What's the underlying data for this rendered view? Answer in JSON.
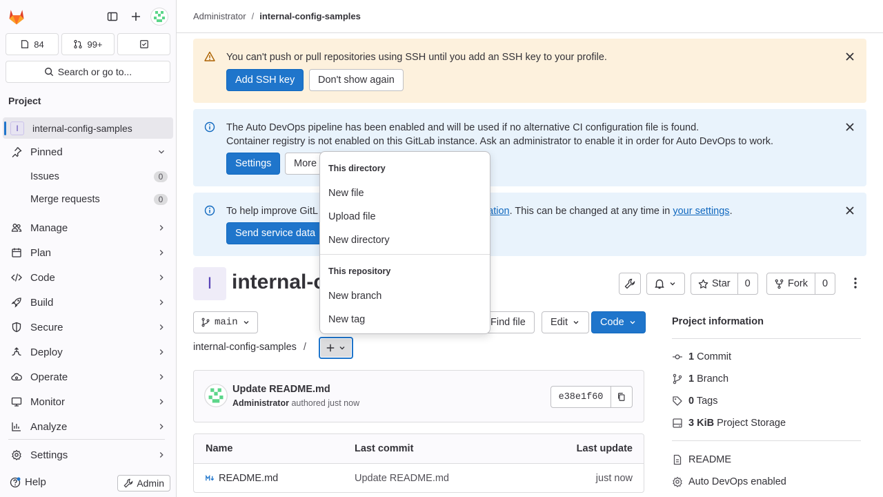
{
  "sidebar": {
    "issues_count": "84",
    "mr_count": "99+",
    "search_label": "Search or go to...",
    "section_title": "Project",
    "project_name": "internal-config-samples",
    "project_initial": "I",
    "pinned_label": "Pinned",
    "pinned_items": [
      {
        "label": "Issues",
        "count": "0"
      },
      {
        "label": "Merge requests",
        "count": "0"
      }
    ],
    "nav": [
      {
        "label": "Manage",
        "icon": "users-icon"
      },
      {
        "label": "Plan",
        "icon": "calendar-icon"
      },
      {
        "label": "Code",
        "icon": "code-icon"
      },
      {
        "label": "Build",
        "icon": "rocket-icon"
      },
      {
        "label": "Secure",
        "icon": "shield-icon"
      },
      {
        "label": "Deploy",
        "icon": "deploy-icon"
      },
      {
        "label": "Operate",
        "icon": "cloud-gear-icon"
      },
      {
        "label": "Monitor",
        "icon": "monitor-icon"
      },
      {
        "label": "Analyze",
        "icon": "chart-icon"
      }
    ],
    "settings_label": "Settings",
    "help_label": "Help",
    "admin_label": "Admin"
  },
  "breadcrumb": {
    "parent": "Administrator",
    "current": "internal-config-samples"
  },
  "alerts": {
    "ssh": {
      "text": "You can't push or pull repositories using SSH until you add an SSH key to your profile.",
      "primary": "Add SSH key",
      "secondary": "Don't show again"
    },
    "devops": {
      "line1": "The Auto DevOps pipeline has been enabled and will be used if no alternative CI configuration file is found.",
      "line2": "Container registry is not enabled on this GitLab instance. Ask an administrator to enable it in order for Auto DevOps to work.",
      "primary": "Settings",
      "secondary": "More"
    },
    "usage": {
      "text_start": "To help improve GitL",
      "link1": "ect usage information",
      "text_mid": ". This can be changed at any time in ",
      "link2": "your settings",
      "text_end": ".",
      "primary": "Send service data"
    }
  },
  "project": {
    "initial": "I",
    "title": "internal-c",
    "star_label": "Star",
    "star_count": "0",
    "fork_label": "Fork",
    "fork_count": "0"
  },
  "repo": {
    "branch": "main",
    "path_root": "internal-config-samples",
    "path_sep": "/",
    "find_file": "Find file",
    "edit": "Edit",
    "code": "Code"
  },
  "commit": {
    "title": "Update README.md",
    "author": "Administrator",
    "meta_suffix": "authored just now",
    "sha": "e38e1f60"
  },
  "files": {
    "headers": {
      "name": "Name",
      "last_commit": "Last commit",
      "last_update": "Last update"
    },
    "rows": [
      {
        "name": "README.md",
        "last_commit": "Update README.md",
        "last_update": "just now"
      }
    ]
  },
  "project_info": {
    "title": "Project information",
    "commits": {
      "count": "1",
      "label": "Commit"
    },
    "branches": {
      "count": "1",
      "label": "Branch"
    },
    "tags": {
      "count": "0",
      "label": "Tags"
    },
    "storage": {
      "count": "3 KiB",
      "label": "Project Storage"
    },
    "readme": "README",
    "autodevops": "Auto DevOps enabled"
  },
  "dropdown": {
    "dir_header": "This directory",
    "dir_items": [
      "New file",
      "Upload file",
      "New directory"
    ],
    "repo_header": "This repository",
    "repo_items": [
      "New branch",
      "New tag"
    ]
  },
  "colors": {
    "primary": "#1f75cb",
    "warning_bg": "#fdf1dd",
    "info_bg": "#e9f3fc",
    "gitlab_orange": "#e24329"
  }
}
